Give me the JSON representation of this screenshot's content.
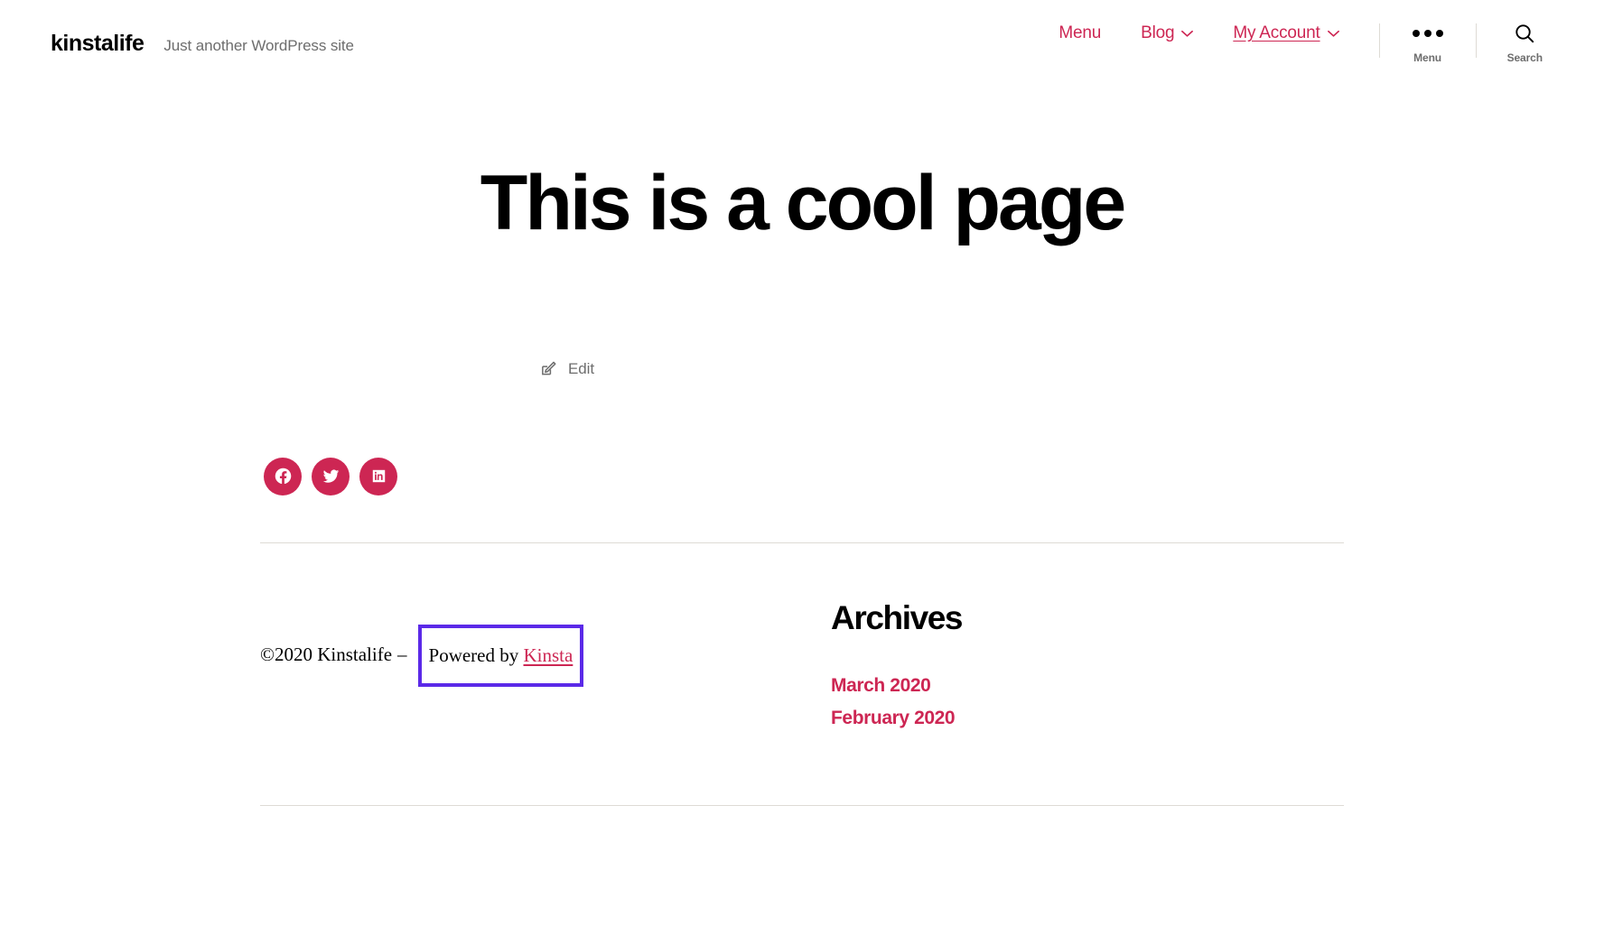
{
  "header": {
    "site_title": "kinstalife",
    "site_description": "Just another WordPress site",
    "nav": [
      {
        "label": "Menu",
        "has_chevron": false,
        "current": false,
        "name": "menu"
      },
      {
        "label": "Blog",
        "has_chevron": true,
        "current": false,
        "name": "blog"
      },
      {
        "label": "My Account",
        "has_chevron": true,
        "current": true,
        "name": "my-account"
      }
    ],
    "menu_toggle": {
      "label": "Menu",
      "icon": "three-dots-icon"
    },
    "search_toggle": {
      "label": "Search",
      "icon": "search-icon"
    }
  },
  "main": {
    "page_title": "This is a cool page",
    "edit_link": {
      "label": "Edit",
      "icon": "edit-pencil-icon"
    }
  },
  "social": [
    {
      "name": "facebook",
      "label": "Facebook"
    },
    {
      "name": "twitter",
      "label": "Twitter"
    },
    {
      "name": "linkedin",
      "label": "LinkedIn"
    }
  ],
  "footer": {
    "copyright": "©2020 Kinstalife",
    "separator": "–",
    "powered_by_prefix": "Powered by ",
    "powered_by_link": "Kinsta",
    "highlight_color": "#5b29e8",
    "widget": {
      "title": "Archives",
      "links": [
        {
          "label": "March 2020"
        },
        {
          "label": "February 2020"
        }
      ]
    }
  },
  "colors": {
    "accent": "#cd2653",
    "text": "#000000",
    "muted": "#6d6d6d",
    "rule": "#dedbd5",
    "highlight": "#5b29e8"
  }
}
